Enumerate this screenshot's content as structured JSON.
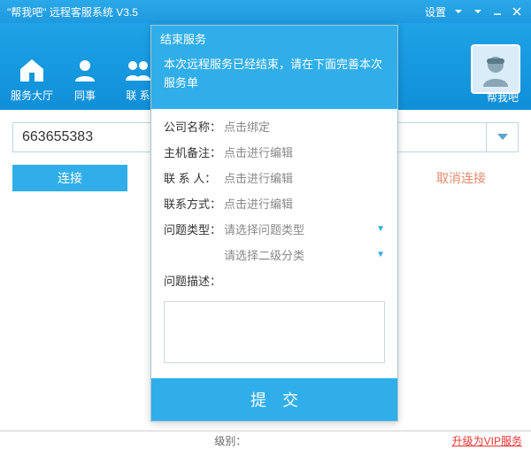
{
  "titlebar": {
    "title": "\"帮我吧\" 远程客服系统 V3.5",
    "settings": "设置"
  },
  "nav": {
    "items": [
      {
        "label": "服务大厅"
      },
      {
        "label": "同事"
      },
      {
        "label": "联 系"
      }
    ],
    "brand": "帮我吧"
  },
  "main": {
    "id_value": "663655383",
    "connect": "连接",
    "cancel": "取消连接"
  },
  "dialog": {
    "title": "结束服务",
    "message": "本次远程服务已经结束，请在下面完善本次服务单",
    "fields": {
      "company_label": "公司名称：",
      "company_value": "点击绑定",
      "hostnote_label": "主机备注：",
      "hostnote_value": "点击进行编辑",
      "contact_label": "联 系 人：",
      "contact_value": "点击进行编辑",
      "contactway_label": "联系方式：",
      "contactway_value": "点击进行编辑",
      "ptype_label": "问题类型：",
      "ptype_value": "请选择问题类型",
      "pcat_value": "请选择二级分类",
      "desc_label": "问题描述："
    },
    "submit": "提交"
  },
  "footer": {
    "level_label": "级别：",
    "vip": "升级为VIP服务"
  }
}
